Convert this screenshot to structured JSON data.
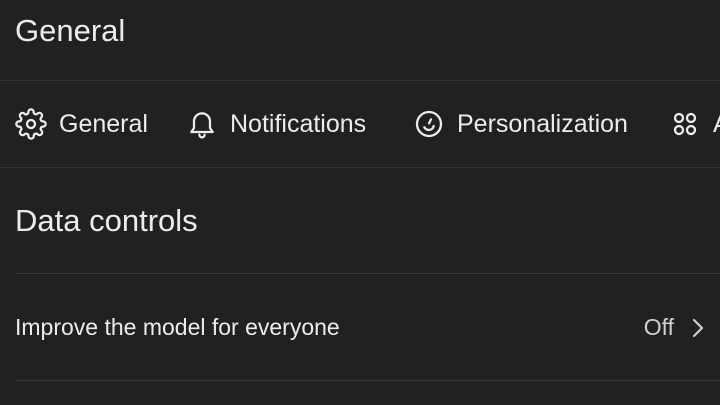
{
  "header": {
    "title": "General"
  },
  "tabs": [
    {
      "label": "General",
      "icon": "gear-icon"
    },
    {
      "label": "Notifications",
      "icon": "bell-icon"
    },
    {
      "label": "Personalization",
      "icon": "personalization-icon"
    },
    {
      "label": "A",
      "icon": "apps-grid-icon"
    }
  ],
  "section": {
    "title": "Data controls"
  },
  "settings": [
    {
      "label": "Improve the model for everyone",
      "value": "Off"
    }
  ],
  "colors": {
    "background": "#212121",
    "text": "#ececec",
    "divider": "#333333"
  }
}
